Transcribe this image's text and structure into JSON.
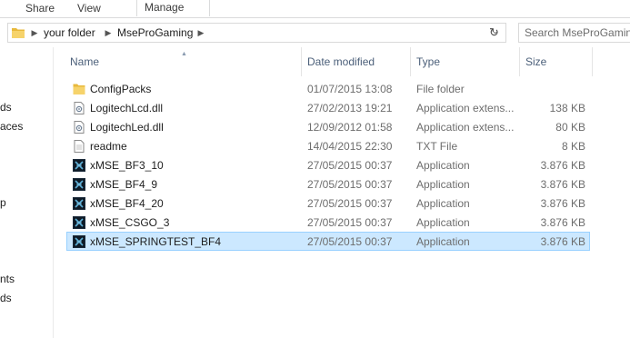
{
  "ribbon": {
    "tabs": [
      "Share",
      "View",
      "Manage"
    ]
  },
  "address": {
    "crumbs": [
      "your folder",
      "MseProGaming"
    ]
  },
  "search": {
    "placeholder": "Search MseProGaming"
  },
  "nav": {
    "items": [
      "ds",
      "aces",
      "p",
      "nts",
      "ds"
    ]
  },
  "columns": {
    "name": "Name",
    "date": "Date modified",
    "type": "Type",
    "size": "Size"
  },
  "files": [
    {
      "name": "ConfigPacks",
      "date": "01/07/2015 13:08",
      "type": "File folder",
      "size": "",
      "icon": "folder-icon"
    },
    {
      "name": "LogitechLcd.dll",
      "date": "27/02/2013 19:21",
      "type": "Application extens...",
      "size": "138 KB",
      "icon": "dll-file-icon"
    },
    {
      "name": "LogitechLed.dll",
      "date": "12/09/2012 01:58",
      "type": "Application extens...",
      "size": "80 KB",
      "icon": "dll-file-icon"
    },
    {
      "name": "readme",
      "date": "14/04/2015 22:30",
      "type": "TXT File",
      "size": "8 KB",
      "icon": "text-file-icon"
    },
    {
      "name": "xMSE_BF3_10",
      "date": "27/05/2015 00:37",
      "type": "Application",
      "size": "3.876 KB",
      "icon": "app-icon"
    },
    {
      "name": "xMSE_BF4_9",
      "date": "27/05/2015 00:37",
      "type": "Application",
      "size": "3.876 KB",
      "icon": "app-icon"
    },
    {
      "name": "xMSE_BF4_20",
      "date": "27/05/2015 00:37",
      "type": "Application",
      "size": "3.876 KB",
      "icon": "app-icon"
    },
    {
      "name": "xMSE_CSGO_3",
      "date": "27/05/2015 00:37",
      "type": "Application",
      "size": "3.876 KB",
      "icon": "app-icon"
    },
    {
      "name": "xMSE_SPRINGTEST_BF4",
      "date": "27/05/2015 00:37",
      "type": "Application",
      "size": "3.876 KB",
      "icon": "app-icon",
      "selected": true
    }
  ],
  "colors": {
    "selection": "#cce8ff",
    "selection_border": "#99d1ff",
    "header_text": "#4c607a"
  }
}
